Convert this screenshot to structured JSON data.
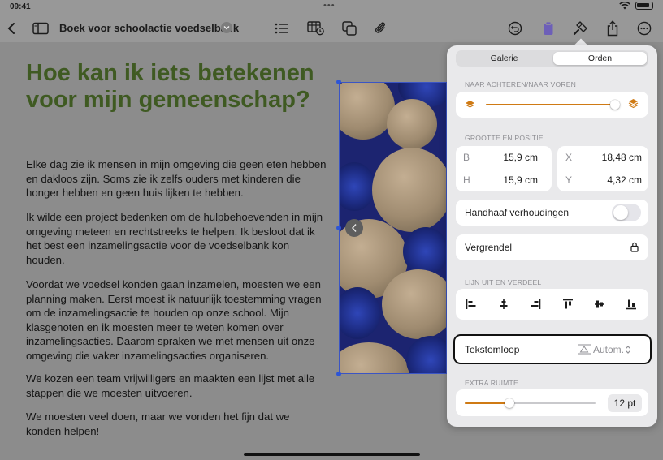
{
  "status_bar": {
    "time": "09:41",
    "dots": "•••"
  },
  "toolbar": {
    "document_title": "Boek voor schoolactie voedselbank",
    "icons": [
      "back-chevron-icon",
      "sidebar-icon",
      "list-icon",
      "insert-table-icon",
      "shapes-icon",
      "paperclip-icon",
      "undo-icon",
      "paste-icon",
      "format-brush-icon",
      "share-icon",
      "more-icon"
    ]
  },
  "document": {
    "heading": "Hoe kan ik iets betekenen voor mijn gemeenschap?",
    "paragraphs": [
      "Elke dag zie ik mensen in mijn omgeving die geen eten hebben en dakloos zijn. Soms zie ik zelfs ouders met kinderen die honger hebben en geen huis lijken te hebben.",
      "Ik wilde een project bedenken om de hulpbehoevenden in mijn omgeving meteen en rechtstreeks te helpen. Ik besloot dat ik het best een inzamelingsactie voor de voedselbank kon houden.",
      "Voordat we voedsel konden gaan inzamelen, moesten we een planning maken. Eerst moest ik natuurlijk toestemming vragen om de inzamelingsactie te houden op onze school. Mijn klasgenoten en ik moesten meer te weten komen over inzamelingsacties. Daarom spraken we met mensen uit onze omgeving die vaker inzamelingsacties organiseren.",
      "We kozen een team vrijwilligers en maakten een lijst met alle stappen die we moesten uitvoeren.",
      "We moesten veel doen, maar we vonden het fijn dat we konden helpen!"
    ]
  },
  "panel": {
    "tabs": [
      {
        "label": "Galerie",
        "active": false
      },
      {
        "label": "Orden",
        "active": true
      }
    ],
    "layer_section_label": "NAAR ACHTEREN/NAAR VOREN",
    "layer_slider_fraction": 0.98,
    "size_section_label": "GROOTTE EN POSITIE",
    "size": {
      "b_label": "B",
      "b_value": "15,9 cm",
      "h_label": "H",
      "h_value": "15,9 cm",
      "x_label": "X",
      "x_value": "18,48 cm",
      "y_label": "Y",
      "y_value": "4,32 cm"
    },
    "constrain_label": "Handhaaf verhoudingen",
    "constrain_on": false,
    "lock_label": "Vergrendel",
    "align_section_label": "LIJN UIT EN VERDEEL",
    "align_icons": [
      "align-left-icon",
      "align-center-icon",
      "align-right-icon",
      "align-top-icon",
      "align-middle-icon",
      "align-bottom-icon"
    ],
    "wrap_label": "Tekstomloop",
    "wrap_value": "Autom.",
    "spacing_section_label": "EXTRA RUIMTE",
    "spacing_slider_fraction": 0.34,
    "spacing_value": "12 pt"
  },
  "colors": {
    "accent": "#cf7a14",
    "heading": "#3f5a22",
    "selection": "#2d55d6"
  }
}
